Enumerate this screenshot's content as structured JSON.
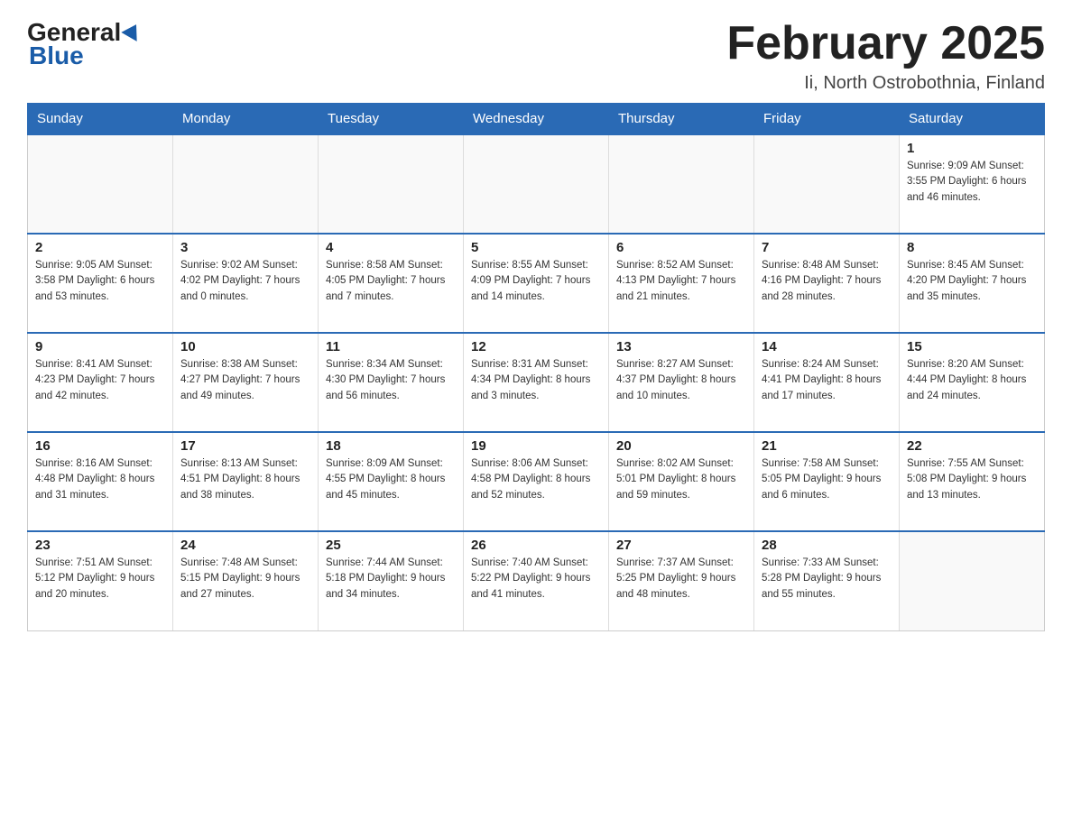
{
  "header": {
    "title": "February 2025",
    "subtitle": "Ii, North Ostrobothnia, Finland",
    "logo_general": "General",
    "logo_blue": "Blue"
  },
  "weekdays": [
    "Sunday",
    "Monday",
    "Tuesday",
    "Wednesday",
    "Thursday",
    "Friday",
    "Saturday"
  ],
  "weeks": [
    [
      {
        "day": "",
        "info": ""
      },
      {
        "day": "",
        "info": ""
      },
      {
        "day": "",
        "info": ""
      },
      {
        "day": "",
        "info": ""
      },
      {
        "day": "",
        "info": ""
      },
      {
        "day": "",
        "info": ""
      },
      {
        "day": "1",
        "info": "Sunrise: 9:09 AM\nSunset: 3:55 PM\nDaylight: 6 hours\nand 46 minutes."
      }
    ],
    [
      {
        "day": "2",
        "info": "Sunrise: 9:05 AM\nSunset: 3:58 PM\nDaylight: 6 hours\nand 53 minutes."
      },
      {
        "day": "3",
        "info": "Sunrise: 9:02 AM\nSunset: 4:02 PM\nDaylight: 7 hours\nand 0 minutes."
      },
      {
        "day": "4",
        "info": "Sunrise: 8:58 AM\nSunset: 4:05 PM\nDaylight: 7 hours\nand 7 minutes."
      },
      {
        "day": "5",
        "info": "Sunrise: 8:55 AM\nSunset: 4:09 PM\nDaylight: 7 hours\nand 14 minutes."
      },
      {
        "day": "6",
        "info": "Sunrise: 8:52 AM\nSunset: 4:13 PM\nDaylight: 7 hours\nand 21 minutes."
      },
      {
        "day": "7",
        "info": "Sunrise: 8:48 AM\nSunset: 4:16 PM\nDaylight: 7 hours\nand 28 minutes."
      },
      {
        "day": "8",
        "info": "Sunrise: 8:45 AM\nSunset: 4:20 PM\nDaylight: 7 hours\nand 35 minutes."
      }
    ],
    [
      {
        "day": "9",
        "info": "Sunrise: 8:41 AM\nSunset: 4:23 PM\nDaylight: 7 hours\nand 42 minutes."
      },
      {
        "day": "10",
        "info": "Sunrise: 8:38 AM\nSunset: 4:27 PM\nDaylight: 7 hours\nand 49 minutes."
      },
      {
        "day": "11",
        "info": "Sunrise: 8:34 AM\nSunset: 4:30 PM\nDaylight: 7 hours\nand 56 minutes."
      },
      {
        "day": "12",
        "info": "Sunrise: 8:31 AM\nSunset: 4:34 PM\nDaylight: 8 hours\nand 3 minutes."
      },
      {
        "day": "13",
        "info": "Sunrise: 8:27 AM\nSunset: 4:37 PM\nDaylight: 8 hours\nand 10 minutes."
      },
      {
        "day": "14",
        "info": "Sunrise: 8:24 AM\nSunset: 4:41 PM\nDaylight: 8 hours\nand 17 minutes."
      },
      {
        "day": "15",
        "info": "Sunrise: 8:20 AM\nSunset: 4:44 PM\nDaylight: 8 hours\nand 24 minutes."
      }
    ],
    [
      {
        "day": "16",
        "info": "Sunrise: 8:16 AM\nSunset: 4:48 PM\nDaylight: 8 hours\nand 31 minutes."
      },
      {
        "day": "17",
        "info": "Sunrise: 8:13 AM\nSunset: 4:51 PM\nDaylight: 8 hours\nand 38 minutes."
      },
      {
        "day": "18",
        "info": "Sunrise: 8:09 AM\nSunset: 4:55 PM\nDaylight: 8 hours\nand 45 minutes."
      },
      {
        "day": "19",
        "info": "Sunrise: 8:06 AM\nSunset: 4:58 PM\nDaylight: 8 hours\nand 52 minutes."
      },
      {
        "day": "20",
        "info": "Sunrise: 8:02 AM\nSunset: 5:01 PM\nDaylight: 8 hours\nand 59 minutes."
      },
      {
        "day": "21",
        "info": "Sunrise: 7:58 AM\nSunset: 5:05 PM\nDaylight: 9 hours\nand 6 minutes."
      },
      {
        "day": "22",
        "info": "Sunrise: 7:55 AM\nSunset: 5:08 PM\nDaylight: 9 hours\nand 13 minutes."
      }
    ],
    [
      {
        "day": "23",
        "info": "Sunrise: 7:51 AM\nSunset: 5:12 PM\nDaylight: 9 hours\nand 20 minutes."
      },
      {
        "day": "24",
        "info": "Sunrise: 7:48 AM\nSunset: 5:15 PM\nDaylight: 9 hours\nand 27 minutes."
      },
      {
        "day": "25",
        "info": "Sunrise: 7:44 AM\nSunset: 5:18 PM\nDaylight: 9 hours\nand 34 minutes."
      },
      {
        "day": "26",
        "info": "Sunrise: 7:40 AM\nSunset: 5:22 PM\nDaylight: 9 hours\nand 41 minutes."
      },
      {
        "day": "27",
        "info": "Sunrise: 7:37 AM\nSunset: 5:25 PM\nDaylight: 9 hours\nand 48 minutes."
      },
      {
        "day": "28",
        "info": "Sunrise: 7:33 AM\nSunset: 5:28 PM\nDaylight: 9 hours\nand 55 minutes."
      },
      {
        "day": "",
        "info": ""
      }
    ]
  ]
}
